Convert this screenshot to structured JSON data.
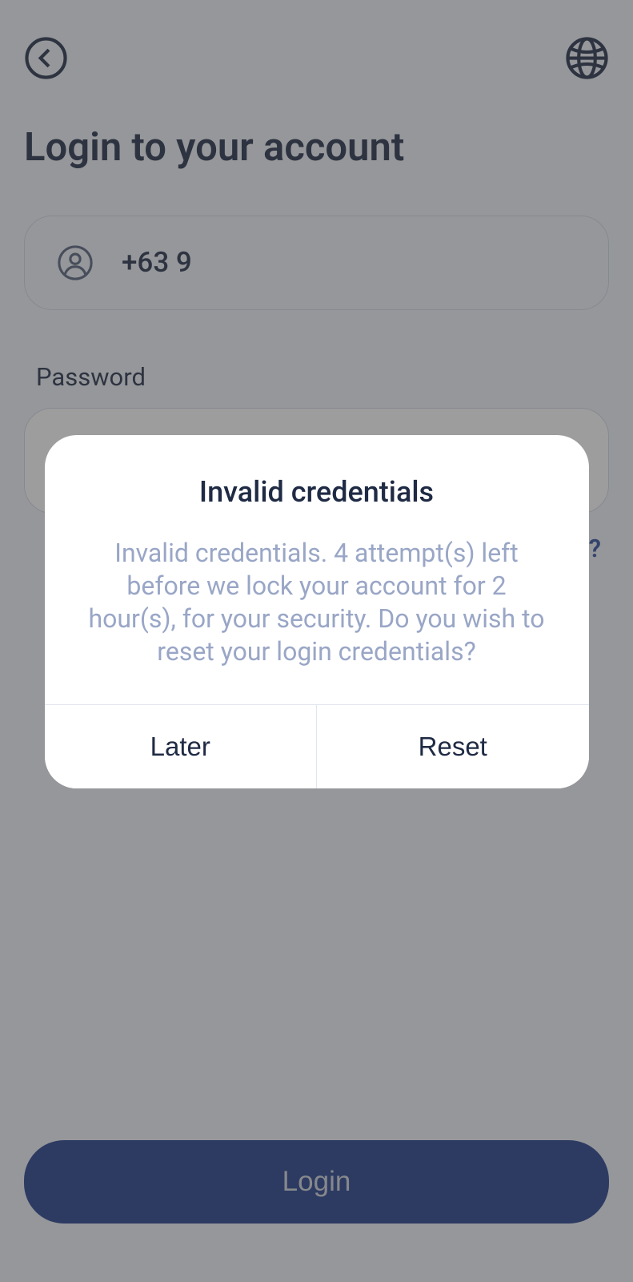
{
  "page": {
    "title": "Login to your account"
  },
  "phone": {
    "value": "+63 9"
  },
  "password": {
    "label": "Password",
    "placeholder": ""
  },
  "forgot": {
    "label": "Forgot Password?"
  },
  "login": {
    "label": "Login"
  },
  "modal": {
    "title": "Invalid credentials",
    "message": "Invalid credentials. 4 attempt(s) left before we lock your account for 2 hour(s), for your security. Do you wish to reset your login credentials?",
    "later_label": "Later",
    "reset_label": "Reset"
  }
}
